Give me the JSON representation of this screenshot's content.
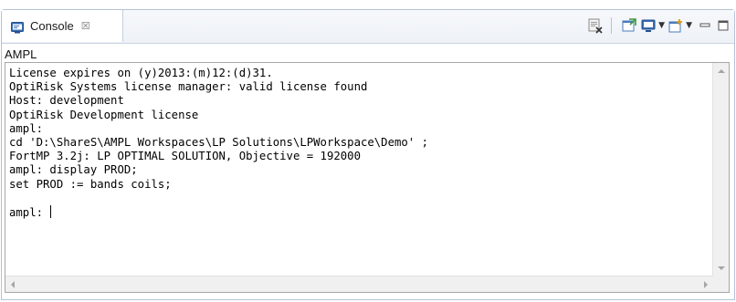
{
  "view": {
    "tab_label": "Console",
    "tab_close_symbol": "☒",
    "tab_icon": "console-icon"
  },
  "toolbar": {
    "icons": [
      "clear-console-icon",
      "pin-console-icon",
      "display-console-icon",
      "open-console-icon",
      "minimize-icon",
      "maximize-icon"
    ],
    "has_dropdowns": true
  },
  "console": {
    "name": "AMPL",
    "lines": [
      "License expires on (y)2013:(m)12:(d)31.",
      "OptiRisk Systems license manager: valid license found",
      "Host: development",
      "OptiRisk Development license",
      "ampl:",
      "cd 'D:\\ShareS\\AMPL Workspaces\\LP Solutions\\LPWorkspace\\Demo' ;",
      "FortMP 3.2j: LP OPTIMAL SOLUTION, Objective = 192000",
      "ampl: display PROD;",
      "set PROD := bands coils;",
      "",
      "ampl: "
    ]
  },
  "colors": {
    "frame_border": "#b5c3d6",
    "tab_background": "#ffffff",
    "strip_background": "#eef2f7",
    "text": "#000000"
  }
}
